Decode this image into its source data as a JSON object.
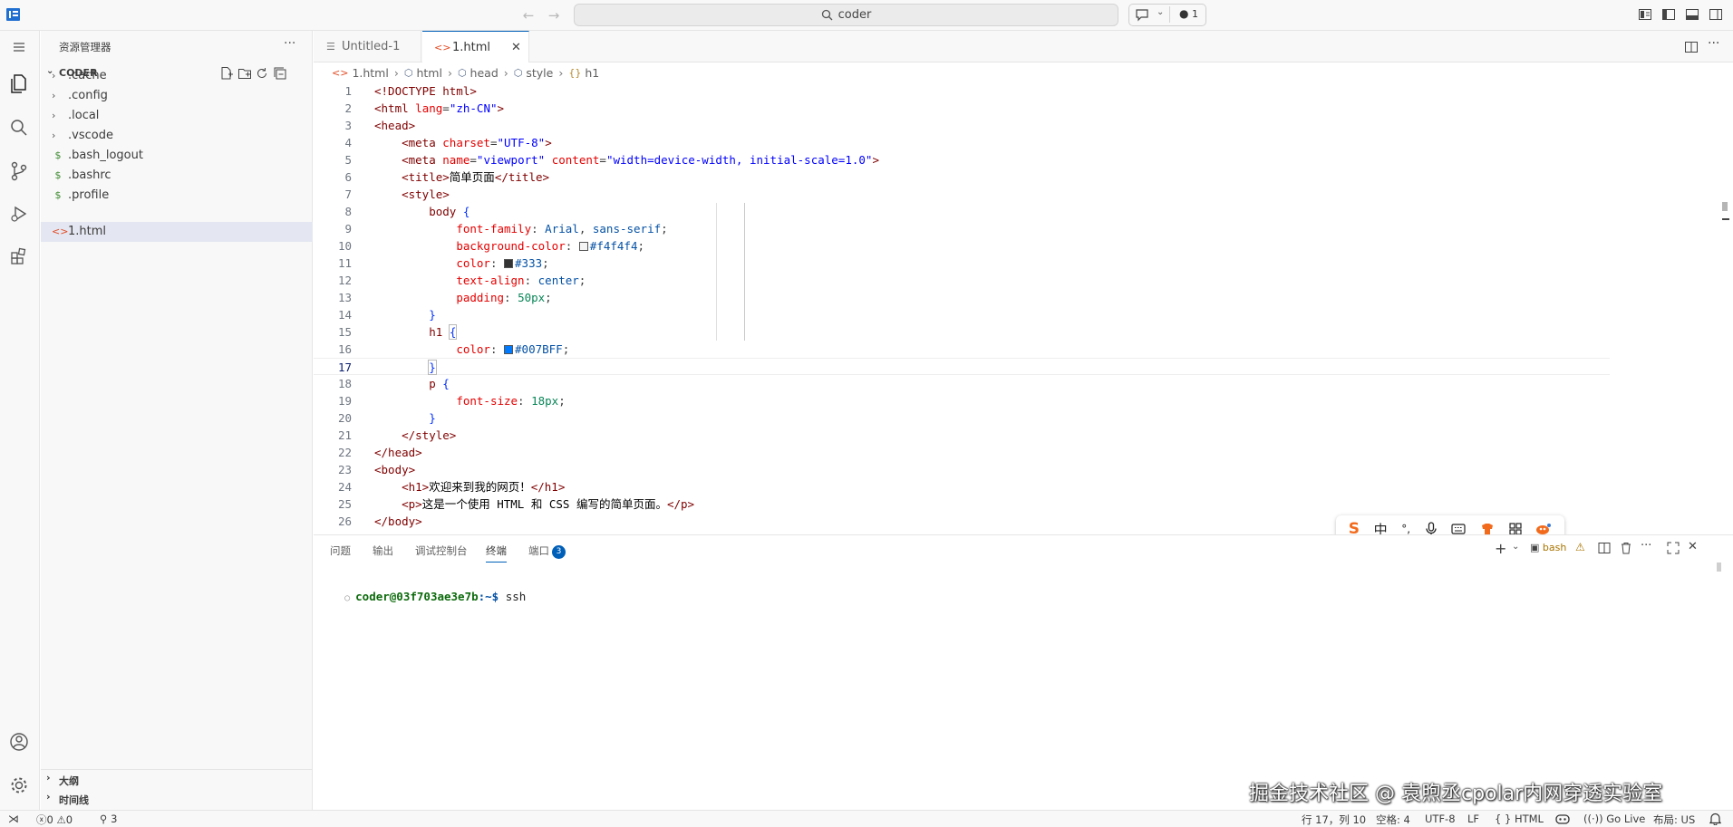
{
  "titlebar": {
    "search_text": "coder",
    "chat_count": "1"
  },
  "sidebar": {
    "title": "资源管理器",
    "root": "CODER",
    "items": [
      {
        "label": ".cache",
        "kind": "folder"
      },
      {
        "label": ".config",
        "kind": "folder"
      },
      {
        "label": ".local",
        "kind": "folder"
      },
      {
        "label": ".vscode",
        "kind": "folder"
      },
      {
        "label": ".bash_logout",
        "kind": "shell"
      },
      {
        "label": ".bashrc",
        "kind": "shell"
      },
      {
        "label": ".profile",
        "kind": "shell"
      },
      {
        "label": "1.html",
        "kind": "html"
      }
    ],
    "outline_label": "大纲",
    "timeline_label": "时间线"
  },
  "tabs": [
    {
      "label": "Untitled-1"
    },
    {
      "label": "1.html"
    }
  ],
  "breadcrumb": [
    "1.html",
    "html",
    "head",
    "style",
    "h1"
  ],
  "editor": {
    "line_numbers": [
      "1",
      "2",
      "3",
      "4",
      "5",
      "6",
      "7",
      "8",
      "9",
      "10",
      "11",
      "12",
      "13",
      "14",
      "15",
      "16",
      "17",
      "18",
      "19",
      "20",
      "21",
      "22",
      "23",
      "24",
      "25",
      "26"
    ],
    "current_line": 17,
    "swatch_colors": {
      "f4f4f4": "#f4f4f4",
      "333": "#333333",
      "007BFF": "#007BFF"
    }
  },
  "panel": {
    "tabs": [
      "问题",
      "输出",
      "调试控制台",
      "终端",
      "端口"
    ],
    "ports_badge": "3",
    "shell_label": "bash",
    "prompt_user": "coder@03f703ae3e7b",
    "prompt_path": ":~$",
    "command": " ssh"
  },
  "ime": {
    "mode": "中",
    "punct": "°,"
  },
  "watermark": "掘金技术社区 @ 袁煦丞cpolar内网穿透实验室",
  "statusbar": {
    "errors": "0",
    "warnings": "0",
    "ports": "3",
    "position": "行 17，列 10",
    "spaces": "空格: 4",
    "encoding": "UTF-8",
    "eol": "LF",
    "language": "{ } HTML",
    "golive": "Go Live",
    "layout": "布局: US"
  },
  "colors": {
    "accent": "#005fb8",
    "tag": "#800000",
    "attr": "#e50000",
    "string": "#0000ff",
    "value": "#0451a5",
    "number": "#098658"
  }
}
